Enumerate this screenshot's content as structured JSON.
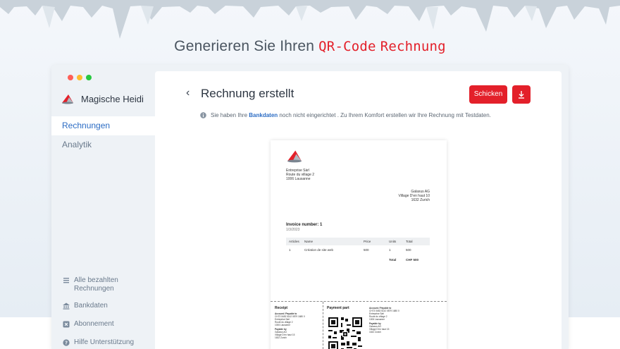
{
  "headline": {
    "prefix": "Generieren Sie Ihren",
    "accent1": "QR-Code",
    "accent2": "Rechnung"
  },
  "colors": {
    "accent": "#e3202a",
    "link": "#2b6cc4",
    "dot_red": "#ff5f57",
    "dot_yellow": "#febc2e",
    "dot_green": "#28c840"
  },
  "sidebar": {
    "brand_name": "Magische Heidi",
    "brand_icon": "hat-logo-icon",
    "nav": [
      {
        "label": "Rechnungen",
        "active": true
      },
      {
        "label": "Analytik",
        "active": false
      }
    ],
    "footer": [
      {
        "icon": "list-icon",
        "label": "Alle bezahlten Rechnungen"
      },
      {
        "icon": "bank-icon",
        "label": "Bankdaten"
      },
      {
        "icon": "subscription-icon",
        "label": "Abonnement"
      },
      {
        "icon": "help-icon",
        "label": "Hilfe Unterstützung"
      }
    ]
  },
  "main": {
    "title": "Rechnung erstellt",
    "back_icon": "chevron-left-icon",
    "send_label": "Schicken",
    "download_icon": "download-icon",
    "info": {
      "icon": "info-icon",
      "before": "Sie haben Ihre",
      "link": "Bankdaten",
      "after": "noch nicht eingerichtet . Zu Ihrem Komfort erstellen wir Ihre Rechnung mit Testdaten."
    }
  },
  "invoice": {
    "sender": [
      "Entreprise Sàrl",
      "Route du village 2",
      "1006 Lausanne"
    ],
    "recipient": [
      "Galaxus AG",
      "Village D'en haut 10",
      "1632 Zurich"
    ],
    "number_label": "Invoice number: 1",
    "date": "1/3/2023",
    "columns": [
      "Articles",
      "Name",
      "Price",
      "Units",
      "Total"
    ],
    "rows": [
      [
        "1",
        "Création de site web",
        "500",
        "1",
        "500"
      ]
    ],
    "total_label": "Total",
    "total_value": "CHF 500",
    "receipt_title": "Receipt",
    "payment_title": "Payment part",
    "account_label": "Account / Payable to",
    "iban": "CH73 0483 5142 0879 1680 0",
    "payable_by_label": "Payable by",
    "creditor": [
      "Entreprise Sàrl",
      "Route du village 2",
      "1006 Lausanne"
    ],
    "debtor": [
      "Galaxus AG",
      "Village D'en haut 15",
      "1632 Zurich"
    ]
  }
}
